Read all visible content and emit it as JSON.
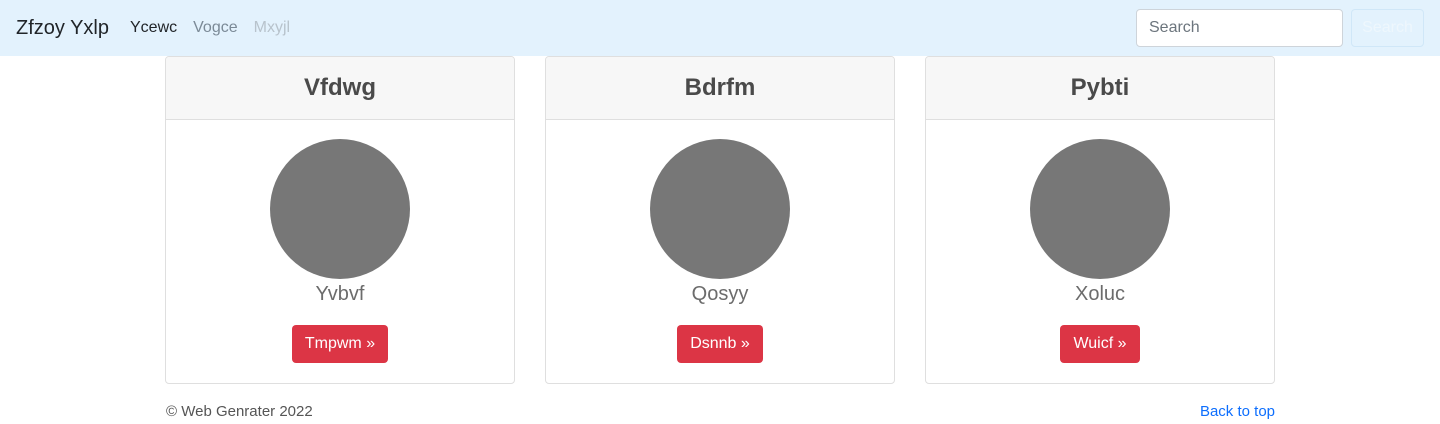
{
  "navbar": {
    "brand": "Zfzoy Yxlp",
    "links": [
      {
        "label": "Ycewc",
        "state": "active"
      },
      {
        "label": "Vogce",
        "state": "normal"
      },
      {
        "label": "Mxyjl",
        "state": "disabled"
      }
    ],
    "search": {
      "placeholder": "Search",
      "button_label": "Search"
    }
  },
  "cards": [
    {
      "title": "Vfdwg",
      "name": "Yvbvf",
      "button_label": "Tmpwm »"
    },
    {
      "title": "Bdrfm",
      "name": "Qosyy",
      "button_label": "Dsnnb »"
    },
    {
      "title": "Pybti",
      "name": "Xoluc",
      "button_label": "Wuicf »"
    }
  ],
  "footer": {
    "copyright": "© Web Genrater 2022",
    "back_to_top": "Back to top"
  },
  "colors": {
    "navbar_bg": "#e3f2fd",
    "button_danger": "#dc3545",
    "avatar_placeholder": "#777777",
    "link": "#0d6efd"
  }
}
